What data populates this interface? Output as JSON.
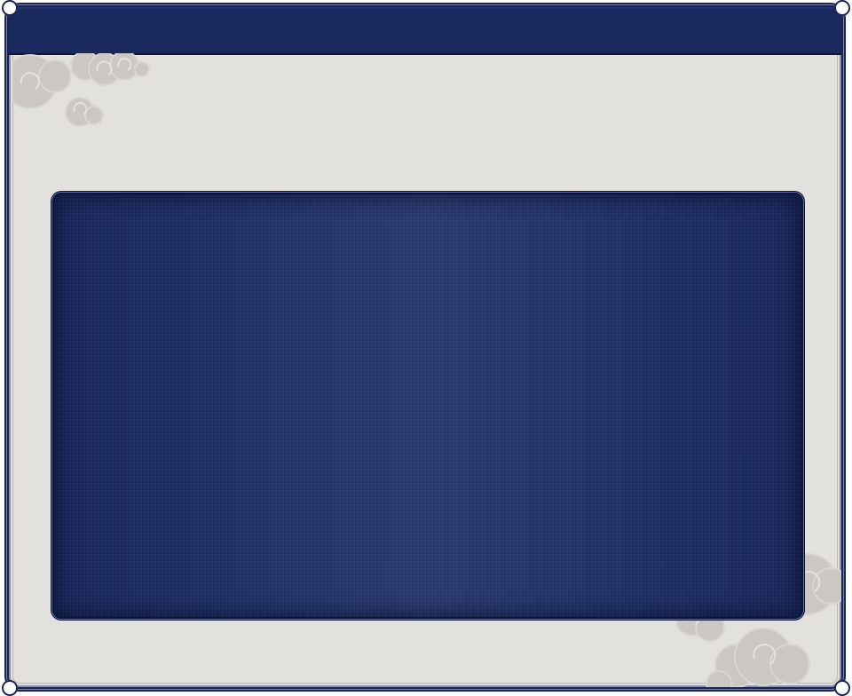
{
  "panel": {
    "header_title": "",
    "content_text": ""
  },
  "decorations": {
    "clouds": [
      "cloud-icon",
      "cloud-icon",
      "cloud-icon",
      "cloud-icon"
    ]
  },
  "colors": {
    "frame_navy": "#1b2a5e",
    "paper": "#e3e1dd",
    "cloud": "#c9c6c1",
    "content_panel": "#22315f"
  }
}
